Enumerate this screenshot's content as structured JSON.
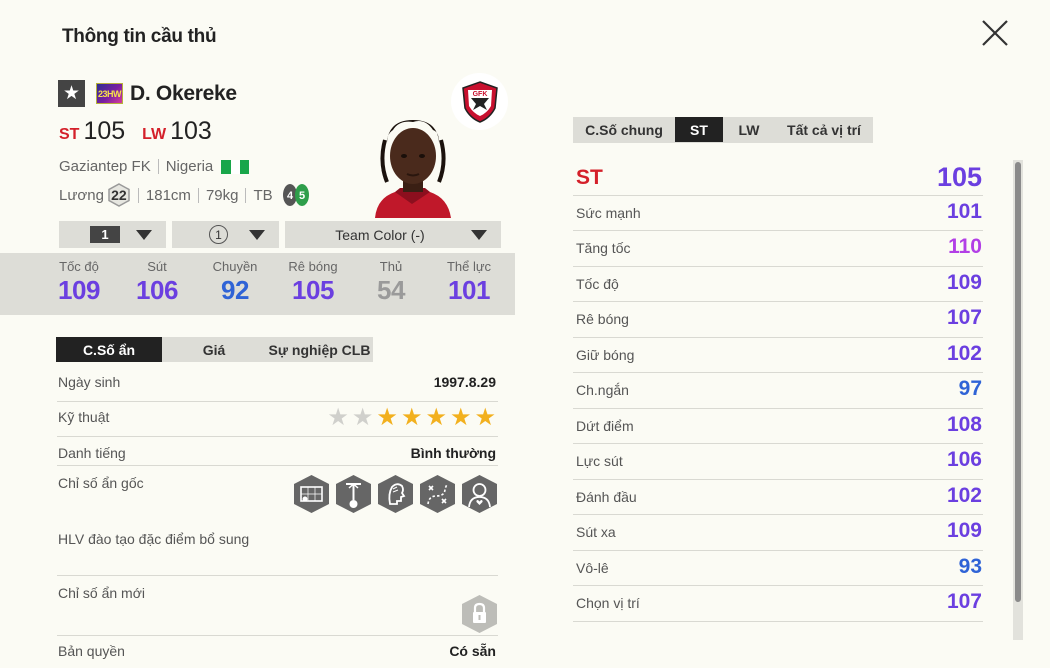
{
  "page_title": "Thông tin cầu thủ",
  "player": {
    "season_badge": "23HW",
    "name": "D. Okereke",
    "positions": [
      {
        "pos": "ST",
        "ovr": "105"
      },
      {
        "pos": "LW",
        "ovr": "103"
      }
    ],
    "club": "Gaziantep FK",
    "nation": "Nigeria",
    "salary_label": "Lương",
    "salary": "22",
    "height": "181cm",
    "weight": "79kg",
    "body_type": "TB",
    "weak_foot": "4",
    "strong_foot": "5",
    "club_logo_text": "GFK"
  },
  "dropdowns": {
    "level": "1",
    "upgrade": "1",
    "team_color": "Team Color (-)"
  },
  "summary_stats": [
    {
      "label": "Tốc độ",
      "value": "109",
      "color": "#6b3fe0"
    },
    {
      "label": "Sút",
      "value": "106",
      "color": "#6b3fe0"
    },
    {
      "label": "Chuyền",
      "value": "92",
      "color": "#2f63d6"
    },
    {
      "label": "Rê bóng",
      "value": "105",
      "color": "#6b3fe0"
    },
    {
      "label": "Thủ",
      "value": "54",
      "color": "#9a9a9a"
    },
    {
      "label": "Thể lực",
      "value": "101",
      "color": "#6b3fe0"
    }
  ],
  "left_tabs": [
    "C.Số ẩn",
    "Giá",
    "Sự nghiệp CLB"
  ],
  "info": {
    "birth_label": "Ngày sinh",
    "birth": "1997.8.29",
    "skill_label": "Kỹ thuật",
    "skill_stars": 5,
    "skill_max": 7,
    "rep_label": "Danh tiếng",
    "rep": "Bình thường",
    "traits_label": "Chỉ số ẩn gốc",
    "traits": [
      "goal-net-icon",
      "ball-tower-icon",
      "head-profile-icon",
      "dribble-path-icon",
      "person-heart-icon"
    ],
    "coach_label": "HLV đào tạo đặc điểm bổ sung",
    "new_traits_label": "Chỉ số ẩn mới",
    "rights_label": "Bản quyền",
    "rights": "Có sẵn"
  },
  "right_tabs": [
    "C.Số chung",
    "ST",
    "LW",
    "Tất cả vị trí"
  ],
  "attributes": [
    {
      "label": "ST",
      "value": "105",
      "color": "#6b3fe0",
      "main": true
    },
    {
      "label": "Sức mạnh",
      "value": "101",
      "color": "#6b3fe0"
    },
    {
      "label": "Tăng tốc",
      "value": "110",
      "color": "#b23fe6"
    },
    {
      "label": "Tốc độ",
      "value": "109",
      "color": "#6b3fe0"
    },
    {
      "label": "Rê bóng",
      "value": "107",
      "color": "#6b3fe0"
    },
    {
      "label": "Giữ bóng",
      "value": "102",
      "color": "#6b3fe0"
    },
    {
      "label": "Ch.ngắn",
      "value": "97",
      "color": "#2f63d6"
    },
    {
      "label": "Dứt điểm",
      "value": "108",
      "color": "#6b3fe0"
    },
    {
      "label": "Lực sút",
      "value": "106",
      "color": "#6b3fe0"
    },
    {
      "label": "Đánh đầu",
      "value": "102",
      "color": "#6b3fe0"
    },
    {
      "label": "Sút xa",
      "value": "109",
      "color": "#6b3fe0"
    },
    {
      "label": "Vô-lê",
      "value": "93",
      "color": "#2f63d6"
    },
    {
      "label": "Chọn vị trí",
      "value": "107",
      "color": "#6b3fe0"
    }
  ],
  "colors": {
    "accent_red": "#d4202a",
    "star_gold": "#f2b01e",
    "star_gray": "#d0d0cc",
    "nigeria_green": "#18a64a"
  }
}
